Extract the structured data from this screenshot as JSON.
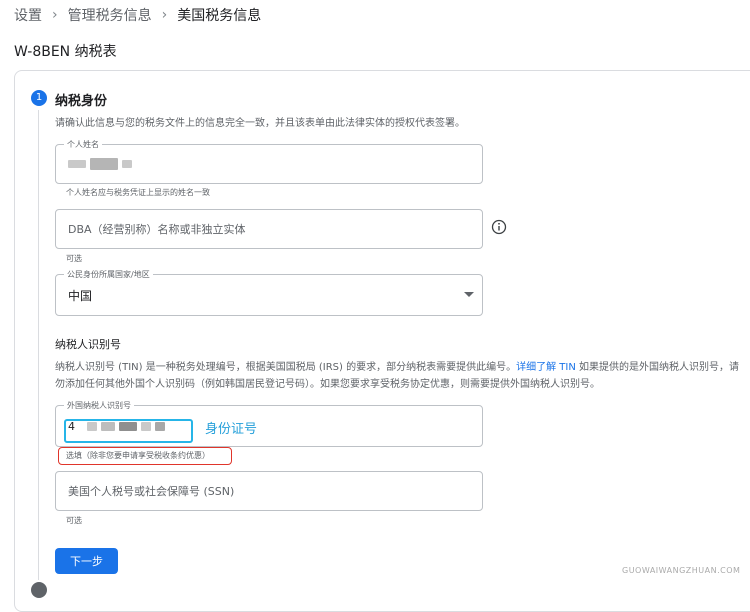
{
  "breadcrumb": {
    "items": [
      "设置",
      "管理税务信息",
      "美国税务信息"
    ]
  },
  "page_title": "W-8BEN 纳税表",
  "step1": {
    "number": "1",
    "title": "纳税身份",
    "description": "请确认此信息与您的税务文件上的信息完全一致，并且该表单由此法律实体的授权代表签署。"
  },
  "fields": {
    "name": {
      "label": "个人姓名",
      "helper": "个人姓名应与税务凭证上显示的姓名一致"
    },
    "dba": {
      "placeholder": "DBA（经营别称）名称或非独立实体",
      "helper": "可选"
    },
    "country": {
      "label": "公民身份所属国家/地区",
      "value": "中国"
    },
    "foreign_tin": {
      "label": "外国纳税人识别号",
      "value_prefix": "4",
      "helper": "选填（除非您要申请享受税收条约优惠）"
    },
    "ssn": {
      "placeholder": "美国个人税号或社会保障号 (SSN)",
      "helper": "可选"
    }
  },
  "tin_section": {
    "title": "纳税人识别号",
    "desc_part1": "纳税人识别号 (TIN) 是一种税务处理编号，根据美国国税局 (IRS) 的要求，部分纳税表需要提供此编号。",
    "link": "详细了解 TIN",
    "desc_part2": " 如果提供的是外国纳税人识别号，请勿添加任何其他外国个人识别码（例如韩国居民登记号码）。如果您要求享受税务协定优惠，则需要提供外国纳税人识别号。"
  },
  "annotation": {
    "text": "身份证号"
  },
  "next_button": {
    "label": "下一步"
  },
  "watermark": "GUOWAIWANGZHUAN.COM",
  "colors": {
    "primary": "#1a73e8",
    "annotation_blue": "#26b5e8",
    "annotation_red": "#e0352b"
  }
}
